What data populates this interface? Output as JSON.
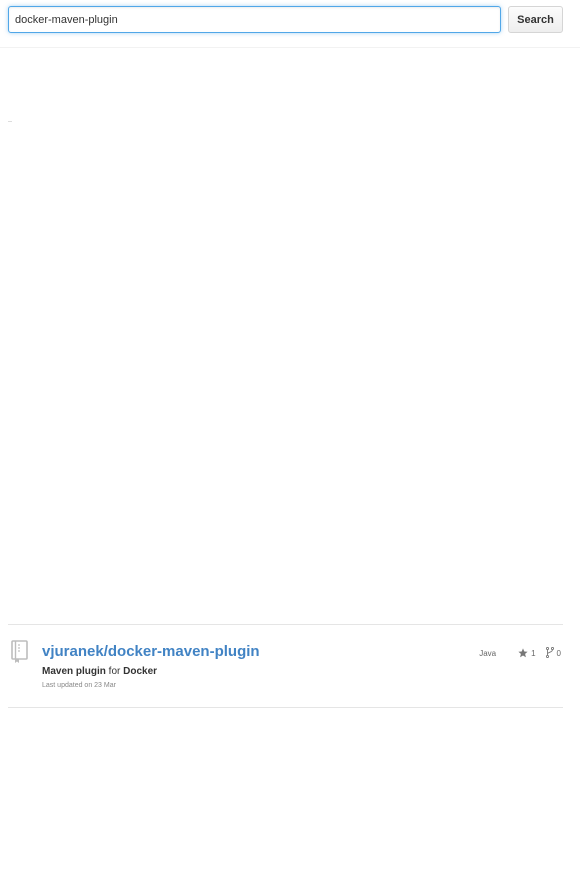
{
  "search": {
    "query": "docker-maven-plugin",
    "button_label": "Search"
  },
  "results": [
    {
      "repo_full_name": "vjuranek/docker-maven-plugin",
      "description": {
        "term1": "Maven plugin",
        "connector": " for ",
        "term2": "Docker"
      },
      "updated": "Last updated on 23 Mar",
      "language": "Java",
      "stars": "1",
      "forks": "0",
      "icons": {
        "repo": "repo-icon",
        "star": "star-icon",
        "fork": "fork-icon"
      }
    }
  ],
  "colors": {
    "link": "#4183c4",
    "focus_border": "#51a7e8",
    "divider": "#e5e5e5"
  }
}
